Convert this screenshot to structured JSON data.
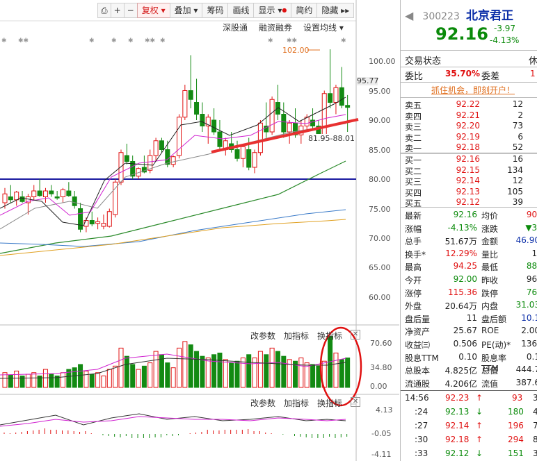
{
  "toolbar": {
    "buttons": [
      "复权",
      "叠加",
      "筹码",
      "画线",
      "显示",
      "简约",
      "隐藏"
    ],
    "active": "复权"
  },
  "top_links": [
    "深股通",
    "融资融券",
    "设置均线"
  ],
  "price_axis": [
    "100.00",
    "95.00",
    "90.00",
    "85.00",
    "80.00",
    "75.00",
    "70.00",
    "65.00",
    "60.00"
  ],
  "current_price_tag": "95.77",
  "high_annotation": "102.00",
  "range_annotation": "81.95-88.01",
  "vol_panel": {
    "links": [
      "改参数",
      "加指标",
      "换指标"
    ],
    "axis": [
      "70.60",
      "34.80",
      "0.00"
    ]
  },
  "macd_panel": {
    "links": [
      "改参数",
      "加指标",
      "换指标"
    ],
    "axis": [
      "4.13",
      "-0.05",
      "-4.11"
    ]
  },
  "quote": {
    "code": "300223",
    "name": "北京君正",
    "price": "92.16",
    "change": "-3.97",
    "change_pct": "-4.13%",
    "trade_status_label": "交易状态",
    "trade_status_value": "休",
    "weibi_label": "委比",
    "weibi_value": "35.70%",
    "weicha_label": "委差",
    "weicha_value": "1",
    "promo": "抓住机会，即刻开户！",
    "sells": [
      {
        "label": "卖五",
        "price": "92.22",
        "vol": "12"
      },
      {
        "label": "卖四",
        "price": "92.21",
        "vol": "2"
      },
      {
        "label": "卖三",
        "price": "92.20",
        "vol": "73"
      },
      {
        "label": "卖二",
        "price": "92.19",
        "vol": "6"
      },
      {
        "label": "卖一",
        "price": "92.18",
        "vol": "52"
      }
    ],
    "buys": [
      {
        "label": "买一",
        "price": "92.16",
        "vol": "16"
      },
      {
        "label": "买二",
        "price": "92.15",
        "vol": "134"
      },
      {
        "label": "买三",
        "price": "92.14",
        "vol": "12"
      },
      {
        "label": "买四",
        "price": "92.13",
        "vol": "105"
      },
      {
        "label": "买五",
        "price": "92.12",
        "vol": "39"
      }
    ],
    "stats": [
      [
        "最新",
        "92.16",
        "均价",
        "90."
      ],
      [
        "涨幅",
        "-4.13%",
        "涨跌",
        "▼3."
      ],
      [
        "总手",
        "51.67万",
        "金额",
        "46.90"
      ],
      [
        "换手*",
        "12.29%",
        "量比",
        "1."
      ],
      [
        "最高",
        "94.25",
        "最低",
        "88."
      ],
      [
        "今开",
        "92.00",
        "昨收",
        "96."
      ],
      [
        "涨停",
        "115.36",
        "跌停",
        "76."
      ],
      [
        "外盘",
        "20.64万",
        "内盘",
        "31.03"
      ],
      [
        "盘后量",
        "11",
        "盘后额",
        "10.1"
      ],
      [
        "净资产",
        "25.67",
        "ROE",
        "2.00"
      ],
      [
        "收益㈢",
        "0.506",
        "PE(动)*",
        "136."
      ],
      [
        "股息TTM",
        "0.10",
        "股息率TTM",
        "0.1"
      ],
      [
        "总股本",
        "4.825亿",
        "总值",
        "444.7"
      ],
      [
        "流通股",
        "4.206亿",
        "流值",
        "387.6"
      ]
    ],
    "ticks": [
      {
        "time": "14:56",
        "price": "92.23",
        "dir": "up",
        "vol": "93",
        "extra": "3"
      },
      {
        "time": ":24",
        "price": "92.13",
        "dir": "down",
        "vol": "180",
        "extra": "4"
      },
      {
        "time": ":27",
        "price": "92.14",
        "dir": "up",
        "vol": "196",
        "extra": "7"
      },
      {
        "time": ":30",
        "price": "92.18",
        "dir": "up",
        "vol": "294",
        "extra": "8"
      },
      {
        "time": ":33",
        "price": "92.12",
        "dir": "down",
        "vol": "151",
        "extra": "3"
      }
    ]
  },
  "colors": {
    "up": "#e01010",
    "down": "#0a8a0a",
    "accent_line": "#e83030",
    "support_line": "#1a1aa0"
  }
}
